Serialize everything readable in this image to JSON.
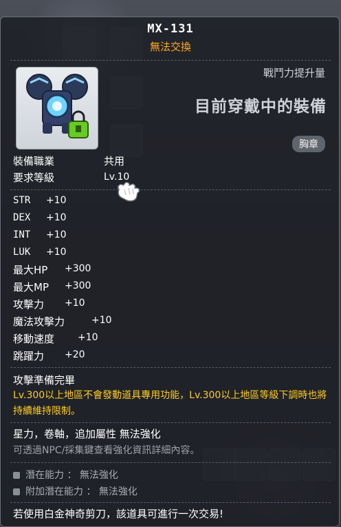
{
  "item": {
    "name": "MX-131",
    "trade_status": "無法交換",
    "power_label": "戰鬥力提升量",
    "equipped_text": "目前穿戴中的裝備",
    "slot": "胸章",
    "icon": "badge-item-icon"
  },
  "requirements": [
    {
      "label": "裝備職業",
      "value": "共用"
    },
    {
      "label": "要求等級",
      "value": "Lv.10"
    }
  ],
  "stats": [
    {
      "label": "STR",
      "value": "+10"
    },
    {
      "label": "DEX",
      "value": "+10"
    },
    {
      "label": "INT",
      "value": "+10"
    },
    {
      "label": "LUK",
      "value": "+10"
    },
    {
      "label": "最大HP",
      "value": "+300"
    },
    {
      "label": "最大MP",
      "value": "+300"
    },
    {
      "label": "攻擊力",
      "value": "+10"
    },
    {
      "label": "魔法攻擊力",
      "value": "+10"
    },
    {
      "label": "移動速度",
      "value": "+10"
    },
    {
      "label": "跳躍力",
      "value": "+20"
    }
  ],
  "ready": {
    "title": "攻擊準備完畢",
    "description": "Lv.300以上地區不會發動道具專用功能，Lv.300以上地區等級下調時也將持續維持限制。"
  },
  "enhance": {
    "text": "星力，卷軸，追加屬性 無法強化",
    "hint": "可透過NPC/採集鍵查看強化資訊詳細內容。"
  },
  "potential": [
    {
      "label": "潛在能力 ： 無法強化"
    },
    {
      "label": "附加潛在能力 ： 無法強化"
    }
  ],
  "footer": "若使用白金神奇剪刀，該道具可進行一次交易!",
  "colors": {
    "trade": "#ffaa22",
    "description": "#ffcc22",
    "panel": "#1c1e24"
  }
}
